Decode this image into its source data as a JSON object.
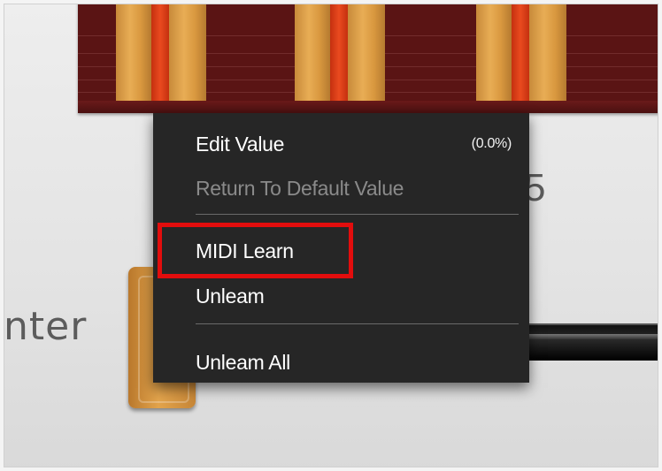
{
  "background": {
    "partial_label": "nter",
    "partial_glyph": "5"
  },
  "context_menu": {
    "items": [
      {
        "label": "Edit Value",
        "value": "(0.0%)",
        "enabled": true
      },
      {
        "label": "Return To Default Value",
        "enabled": false
      },
      {
        "label": "MIDI Learn",
        "enabled": true,
        "highlighted": true
      },
      {
        "label": "Unleam",
        "enabled": true
      },
      {
        "label": "Unleam All",
        "enabled": true
      }
    ]
  },
  "colors": {
    "menu_background": "#262626",
    "highlight_outline": "#e20d0d",
    "key_gold": "#e0a34f",
    "key_red": "#e23f1a",
    "display_background": "#5a1414"
  }
}
